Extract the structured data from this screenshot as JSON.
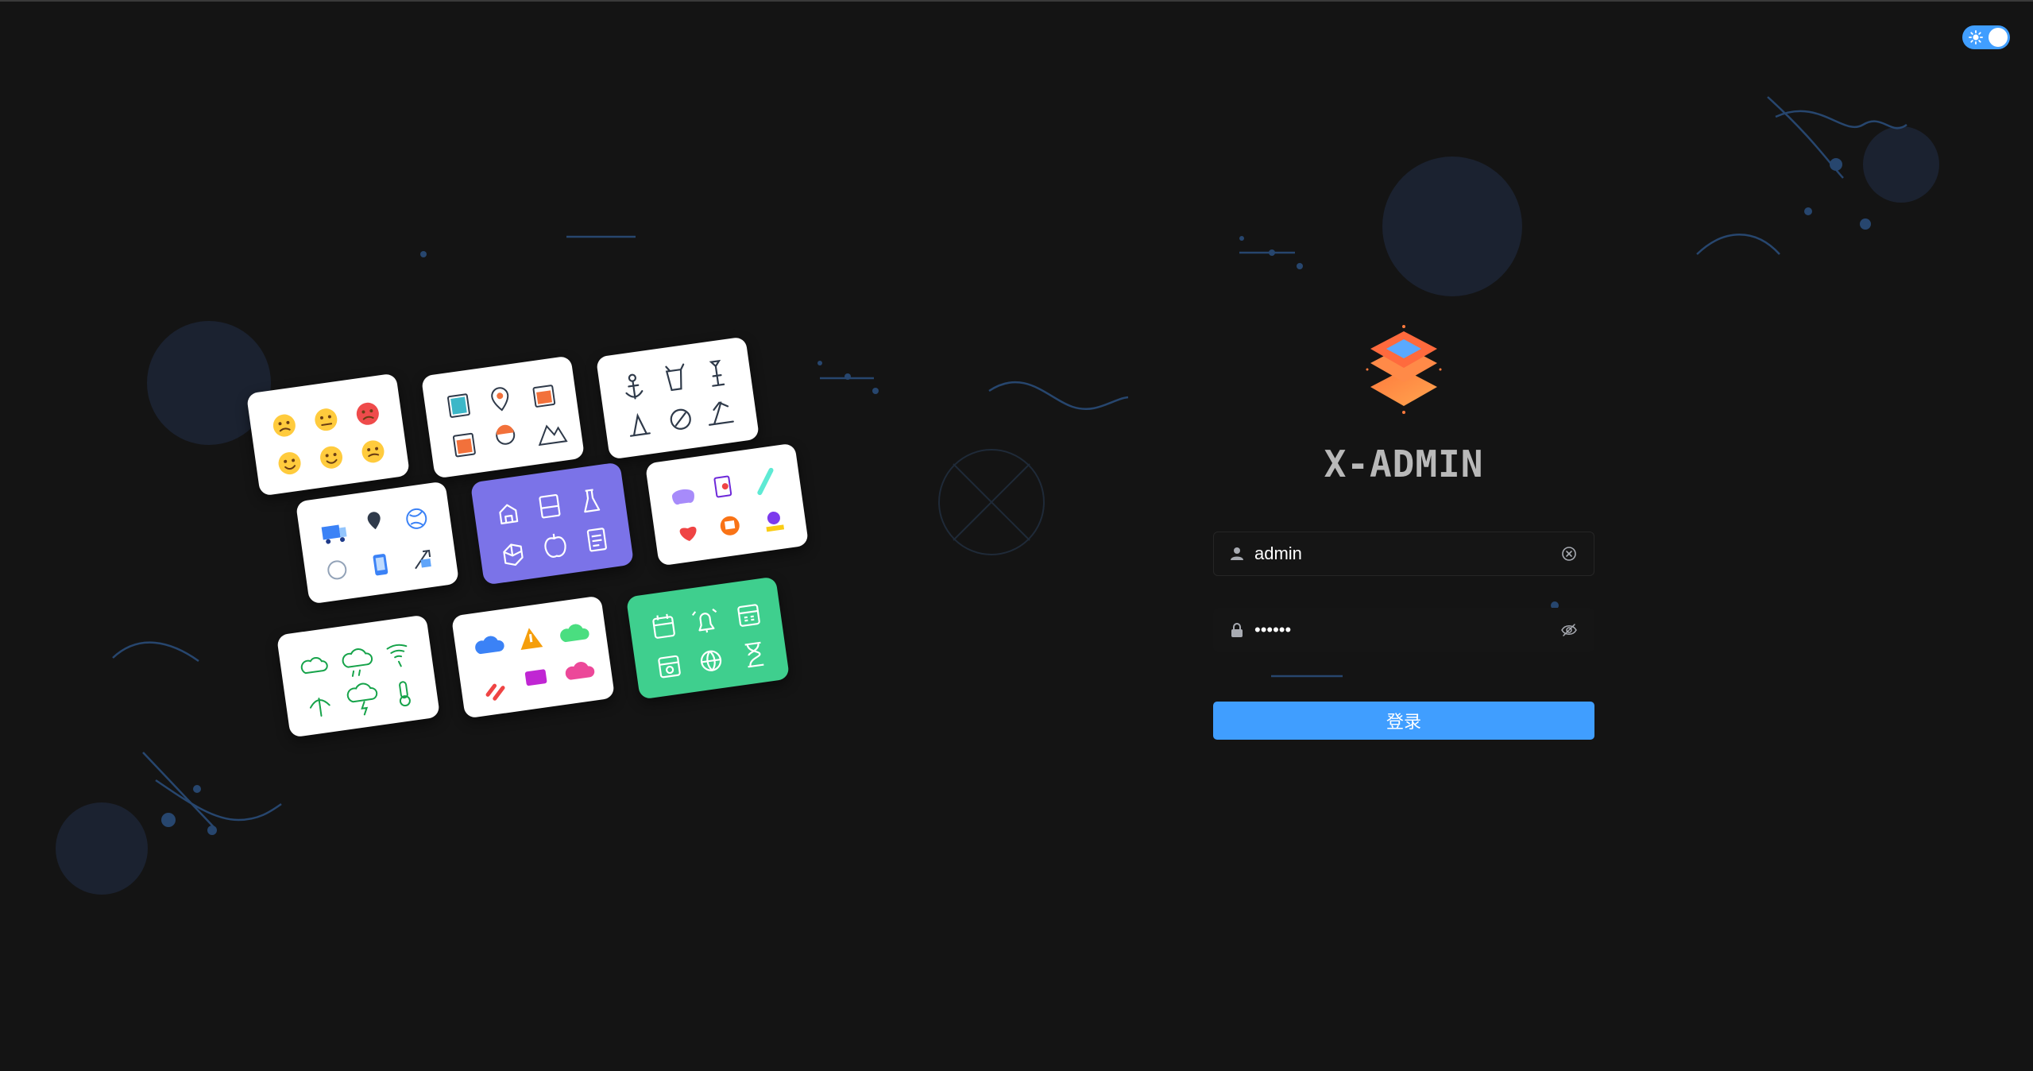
{
  "app": {
    "title": "X-ADMIN"
  },
  "theme_toggle": {
    "icon": "sun-icon",
    "state": "on"
  },
  "login": {
    "username_value": "admin",
    "password_value": "••••••",
    "submit_label": "登录"
  },
  "icons": {
    "username_prefix": "user-icon",
    "password_prefix": "lock-icon",
    "username_suffix": "clear-icon",
    "password_suffix": "eye-off-icon"
  },
  "colors": {
    "background": "#141414",
    "accent": "#409eff",
    "title": "#b9b9b9",
    "illustration_purple": "#7b73e8",
    "illustration_green": "#3fcf8e"
  }
}
